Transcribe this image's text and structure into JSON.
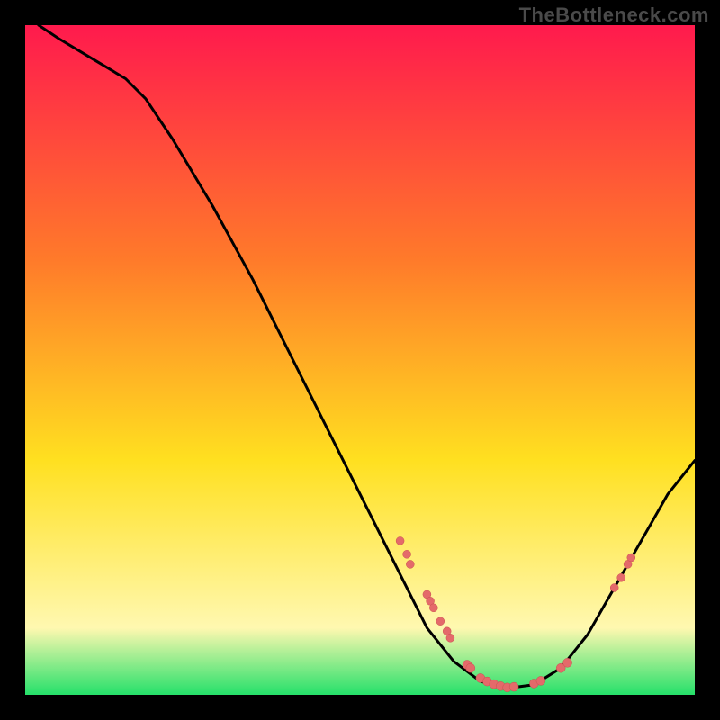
{
  "watermark": "TheBottleneck.com",
  "colors": {
    "bg": "#000000",
    "grad_top": "#ff1a4d",
    "grad_mid1": "#ff7a2a",
    "grad_mid2": "#ffe020",
    "grad_low": "#fff8b0",
    "grad_bottom": "#25e06a",
    "curve": "#000000",
    "marker_fill": "#e46a6a",
    "marker_stroke": "#c94f4f"
  },
  "chart_data": {
    "type": "line",
    "title": "",
    "xlabel": "",
    "ylabel": "",
    "xlim": [
      0,
      100
    ],
    "ylim": [
      0,
      100
    ],
    "curve": [
      {
        "x": 2,
        "y": 100
      },
      {
        "x": 5,
        "y": 98
      },
      {
        "x": 10,
        "y": 95
      },
      {
        "x": 15,
        "y": 92
      },
      {
        "x": 18,
        "y": 89
      },
      {
        "x": 22,
        "y": 83
      },
      {
        "x": 28,
        "y": 73
      },
      {
        "x": 34,
        "y": 62
      },
      {
        "x": 40,
        "y": 50
      },
      {
        "x": 46,
        "y": 38
      },
      {
        "x": 52,
        "y": 26
      },
      {
        "x": 56,
        "y": 18
      },
      {
        "x": 60,
        "y": 10
      },
      {
        "x": 64,
        "y": 5
      },
      {
        "x": 68,
        "y": 2
      },
      {
        "x": 72,
        "y": 1
      },
      {
        "x": 76,
        "y": 1.5
      },
      {
        "x": 80,
        "y": 4
      },
      {
        "x": 84,
        "y": 9
      },
      {
        "x": 88,
        "y": 16
      },
      {
        "x": 92,
        "y": 23
      },
      {
        "x": 96,
        "y": 30
      },
      {
        "x": 100,
        "y": 35
      }
    ],
    "markers": [
      {
        "x": 56,
        "y": 23,
        "r": 4.5
      },
      {
        "x": 57,
        "y": 21,
        "r": 4.5
      },
      {
        "x": 57.5,
        "y": 19.5,
        "r": 4.5
      },
      {
        "x": 60,
        "y": 15,
        "r": 4.5
      },
      {
        "x": 60.5,
        "y": 14,
        "r": 4.5
      },
      {
        "x": 61,
        "y": 13,
        "r": 4.5
      },
      {
        "x": 62,
        "y": 11,
        "r": 4.5
      },
      {
        "x": 63,
        "y": 9.5,
        "r": 4.5
      },
      {
        "x": 63.5,
        "y": 8.5,
        "r": 4.5
      },
      {
        "x": 66,
        "y": 4.5,
        "r": 5
      },
      {
        "x": 66.5,
        "y": 4,
        "r": 5
      },
      {
        "x": 68,
        "y": 2.5,
        "r": 5
      },
      {
        "x": 69,
        "y": 2,
        "r": 5
      },
      {
        "x": 70,
        "y": 1.6,
        "r": 5
      },
      {
        "x": 71,
        "y": 1.3,
        "r": 5
      },
      {
        "x": 72,
        "y": 1.1,
        "r": 5
      },
      {
        "x": 73,
        "y": 1.2,
        "r": 5
      },
      {
        "x": 76,
        "y": 1.7,
        "r": 5
      },
      {
        "x": 77,
        "y": 2.1,
        "r": 5
      },
      {
        "x": 80,
        "y": 4.0,
        "r": 5
      },
      {
        "x": 81,
        "y": 4.8,
        "r": 5
      },
      {
        "x": 88,
        "y": 16,
        "r": 4.5
      },
      {
        "x": 89,
        "y": 17.5,
        "r": 4.5
      },
      {
        "x": 90,
        "y": 19.5,
        "r": 4.5
      },
      {
        "x": 90.5,
        "y": 20.5,
        "r": 4.5
      }
    ]
  }
}
